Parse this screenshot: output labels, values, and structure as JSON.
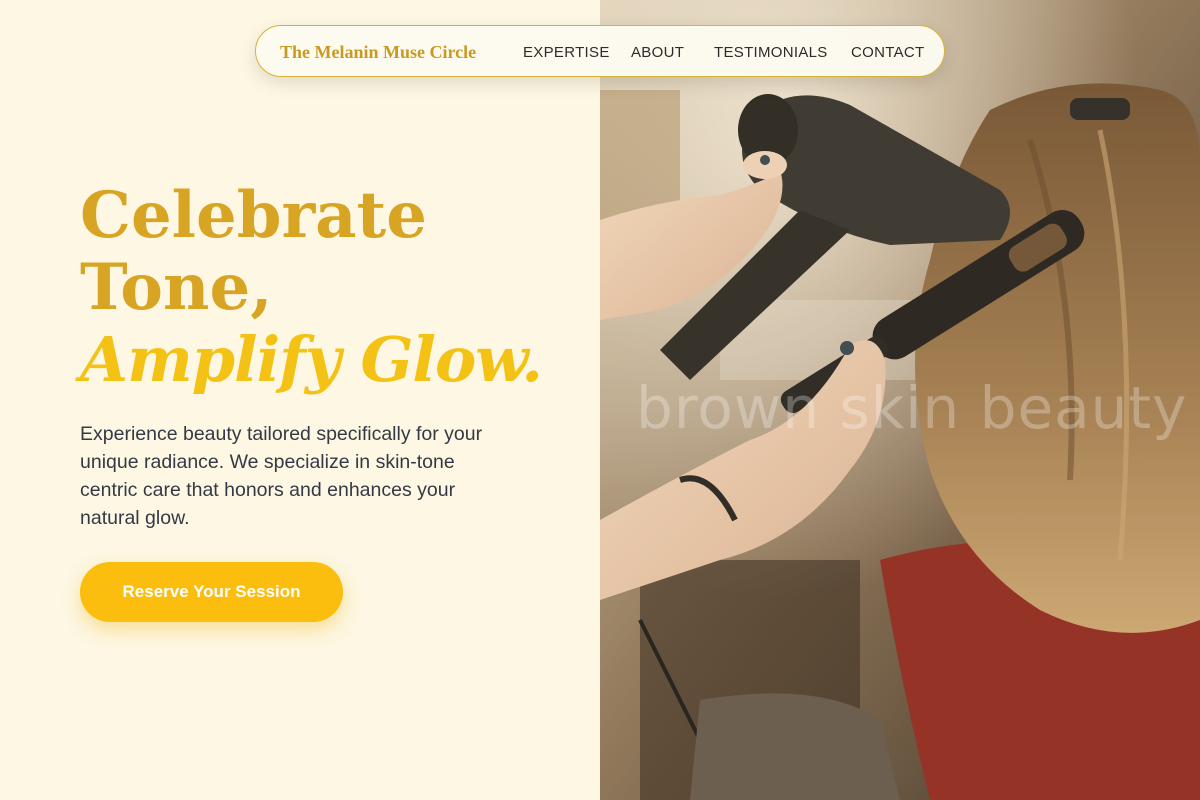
{
  "nav": {
    "brand": "The Melanin Muse Circle",
    "links": [
      "EXPERTISE",
      "ABOUT",
      "TESTIMONIALS",
      "CONTACT"
    ]
  },
  "hero": {
    "title_line1": "Celebrate",
    "title_line2": "Tone,",
    "title_line3": "Amplify Glow.",
    "description": "Experience beauty tailored specifically for your unique radiance. We specialize in skin-tone centric care that honors and enhances your natural glow.",
    "cta_label": "Reserve Your Session"
  },
  "photo": {
    "watermark": "brown skin beauty",
    "subject": "stylist blow-drying hair with round brush"
  },
  "colors": {
    "background": "#fdf7e3",
    "brand_gold": "#c99a20",
    "headline_gold": "#d8a423",
    "accent_yellow": "#f3c214",
    "cta_yellow": "#fbbe0e",
    "body_text": "#343a45"
  }
}
